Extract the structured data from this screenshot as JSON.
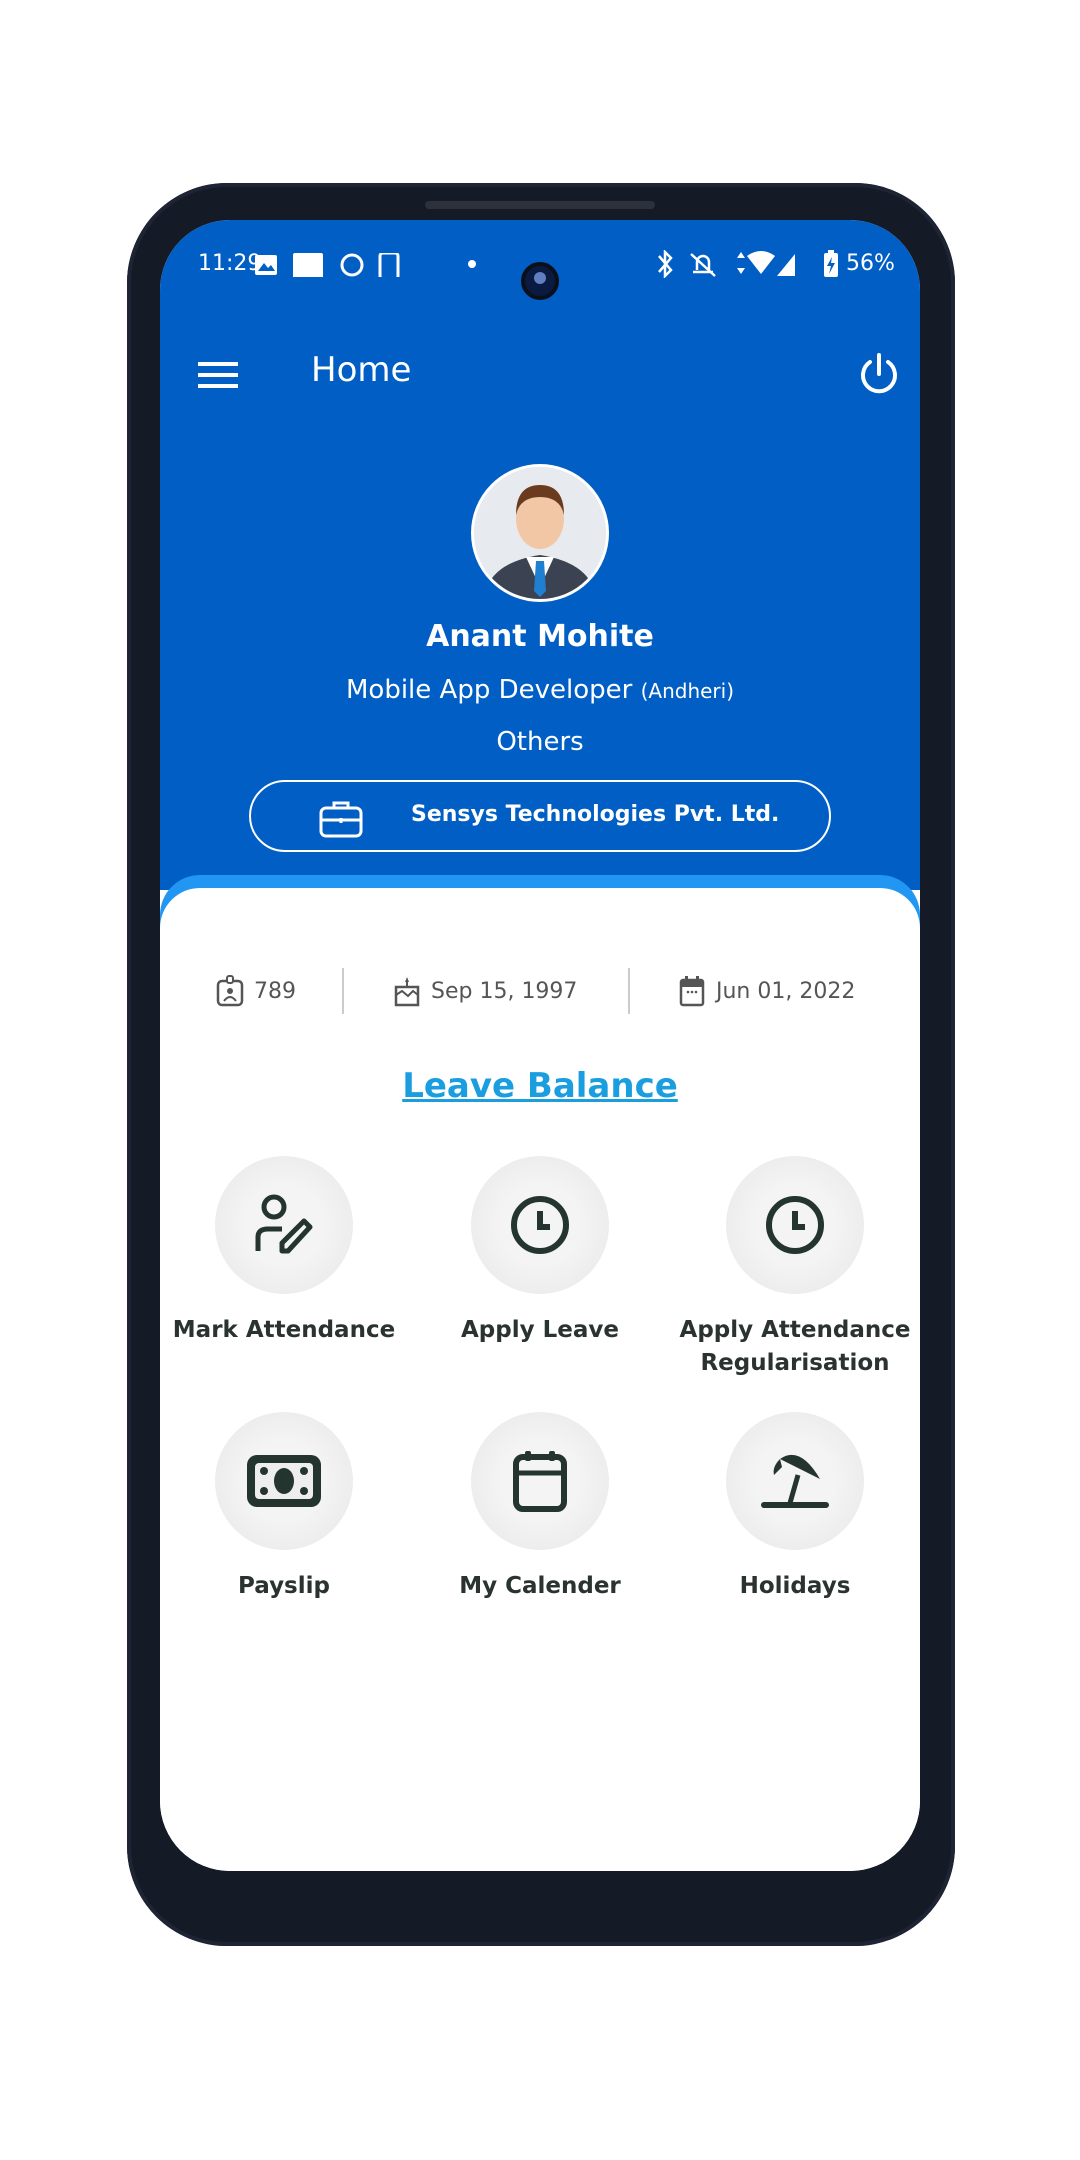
{
  "status_bar": {
    "time": "11:29",
    "battery": "56%"
  },
  "app_bar": {
    "title": "Home"
  },
  "profile": {
    "name": "Anant Mohite",
    "designation": "Mobile App Developer",
    "location": "(Andheri)",
    "department": "Others",
    "company": "Sensys Technologies Pvt. Ltd."
  },
  "info": {
    "employee_id": "789",
    "birth_date": "Sep 15, 1997",
    "joining_date": "Jun 01, 2022"
  },
  "leave_balance_link": "Leave Balance",
  "tiles": [
    {
      "label": "Mark Attendance",
      "icon": "user-edit-icon"
    },
    {
      "label": "Apply Leave",
      "icon": "clock-icon"
    },
    {
      "label": "Apply Attendance Regularisation",
      "icon": "clock-icon"
    },
    {
      "label": "Payslip",
      "icon": "money-icon"
    },
    {
      "label": "My Calender",
      "icon": "calendar-icon"
    },
    {
      "label": "Holidays",
      "icon": "beach-umbrella-icon"
    }
  ],
  "colors": {
    "header": "#005ec4",
    "accent_strip": "#2196f3",
    "link": "#1a9ee0",
    "icon": "#24352f"
  }
}
